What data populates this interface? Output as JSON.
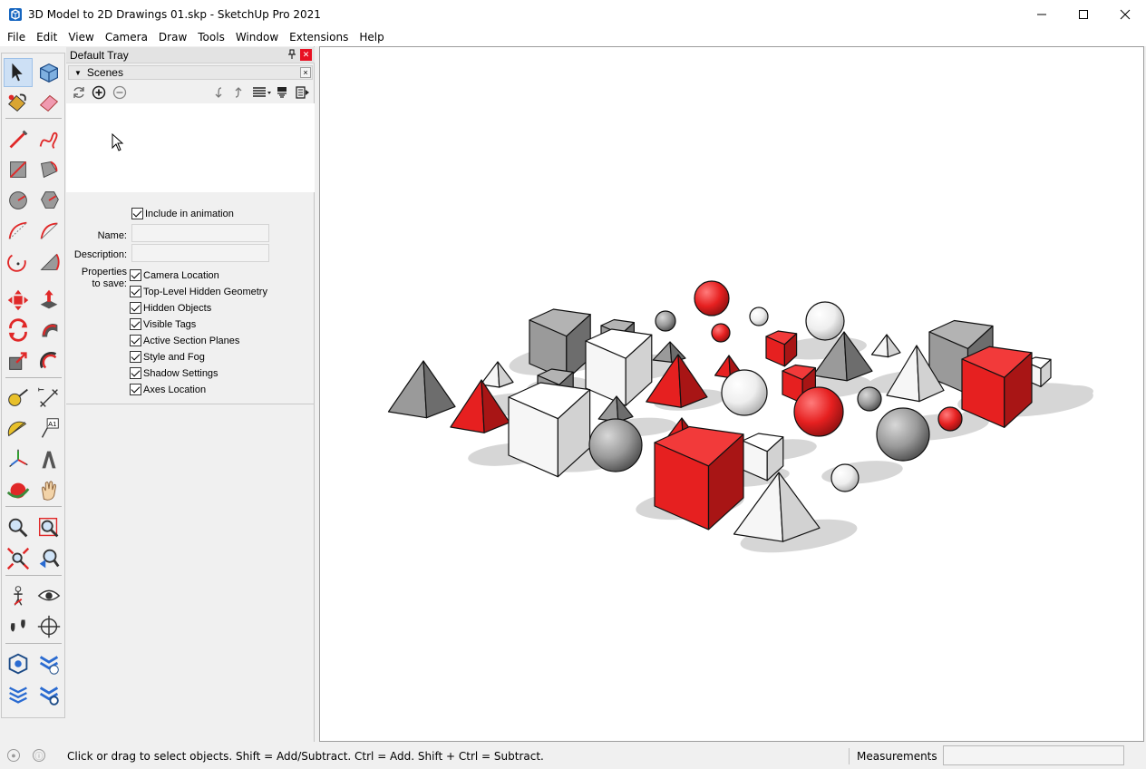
{
  "window": {
    "title": "3D Model to 2D Drawings 01.skp - SketchUp Pro 2021",
    "minimize_glyph": "─",
    "maximize_glyph": "☐",
    "close_glyph": "✕"
  },
  "menu": [
    "File",
    "Edit",
    "View",
    "Camera",
    "Draw",
    "Tools",
    "Window",
    "Extensions",
    "Help"
  ],
  "tray": {
    "title": "Default Tray",
    "pin_glyph": "📌",
    "close_glyph": "✕",
    "scenes": {
      "header": "Scenes",
      "collapse_glyph": "▼",
      "close_glyph": "×",
      "include_in_animation": "Include in animation",
      "name_label": "Name:",
      "name_value": "",
      "description_label": "Description:",
      "description_value": "",
      "properties_label_1": "Properties",
      "properties_label_2": "to save:",
      "properties": [
        "Camera Location",
        "Top-Level Hidden Geometry",
        "Hidden Objects",
        "Visible Tags",
        "Active Section Planes",
        "Style and Fog",
        "Shadow Settings",
        "Axes Location"
      ]
    }
  },
  "tools": [
    "select",
    "components",
    "paint-bucket",
    "eraser",
    "line",
    "freehand",
    "rectangle",
    "rotated-rectangle",
    "circle",
    "polygon",
    "arc",
    "two-point-arc",
    "three-point-arc",
    "pie",
    "move",
    "push-pull",
    "rotate",
    "follow-me",
    "scale",
    "offset",
    "tape-measure",
    "dimensions",
    "protractor",
    "text",
    "axes",
    "3d-text",
    "orbit",
    "pan",
    "zoom",
    "zoom-window",
    "zoom-extents",
    "previous-view",
    "position-camera",
    "look-around",
    "walk",
    "section-plane",
    "warehouse",
    "extension-warehouse",
    "layout",
    "extension-manager"
  ],
  "status": {
    "message": "Click or drag to select objects. Shift = Add/Subtract. Ctrl = Add. Shift + Ctrl = Subtract.",
    "measurements_label": "Measurements",
    "measurements_value": ""
  },
  "colors": {
    "red": "#e62020",
    "grey": "#9a9a9a",
    "white": "#f6f6f6",
    "shadow": "#d6d6d6"
  }
}
